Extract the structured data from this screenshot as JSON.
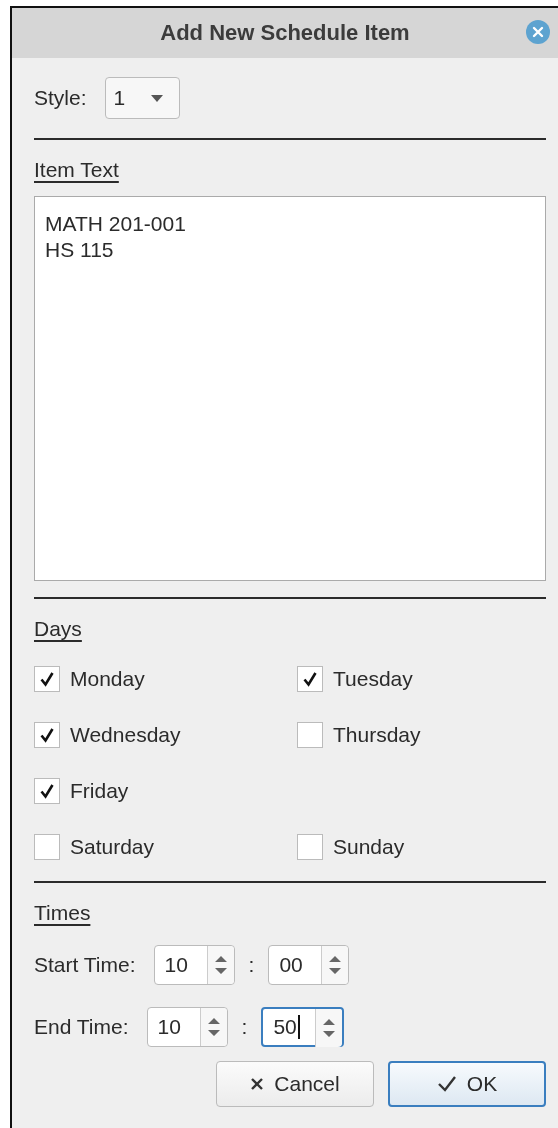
{
  "window": {
    "title": "Add New Schedule Item"
  },
  "style": {
    "label": "Style:",
    "value": "1"
  },
  "item_text": {
    "heading": "Item Text",
    "lines": [
      "MATH 201-001",
      "HS 115"
    ]
  },
  "days": {
    "heading": "Days",
    "rows": [
      [
        {
          "label": "Monday",
          "checked": true
        },
        {
          "label": "Tuesday",
          "checked": true
        }
      ],
      [
        {
          "label": "Wednesday",
          "checked": true
        },
        {
          "label": "Thursday",
          "checked": false
        }
      ],
      [
        {
          "label": "Friday",
          "checked": true
        }
      ],
      [
        {
          "label": "Saturday",
          "checked": false
        },
        {
          "label": "Sunday",
          "checked": false
        }
      ]
    ]
  },
  "times": {
    "heading": "Times",
    "separator": ":",
    "rows": [
      {
        "label": "Start Time:",
        "hour": {
          "value": "10",
          "focused": false
        },
        "minute": {
          "value": "00",
          "focused": false
        }
      },
      {
        "label": "End Time:",
        "hour": {
          "value": "10",
          "focused": false
        },
        "minute": {
          "value": "50",
          "focused": true
        }
      }
    ]
  },
  "buttons": [
    {
      "label": "Cancel",
      "kind": "cancel",
      "default": false
    },
    {
      "label": "OK",
      "kind": "ok",
      "default": true
    }
  ]
}
